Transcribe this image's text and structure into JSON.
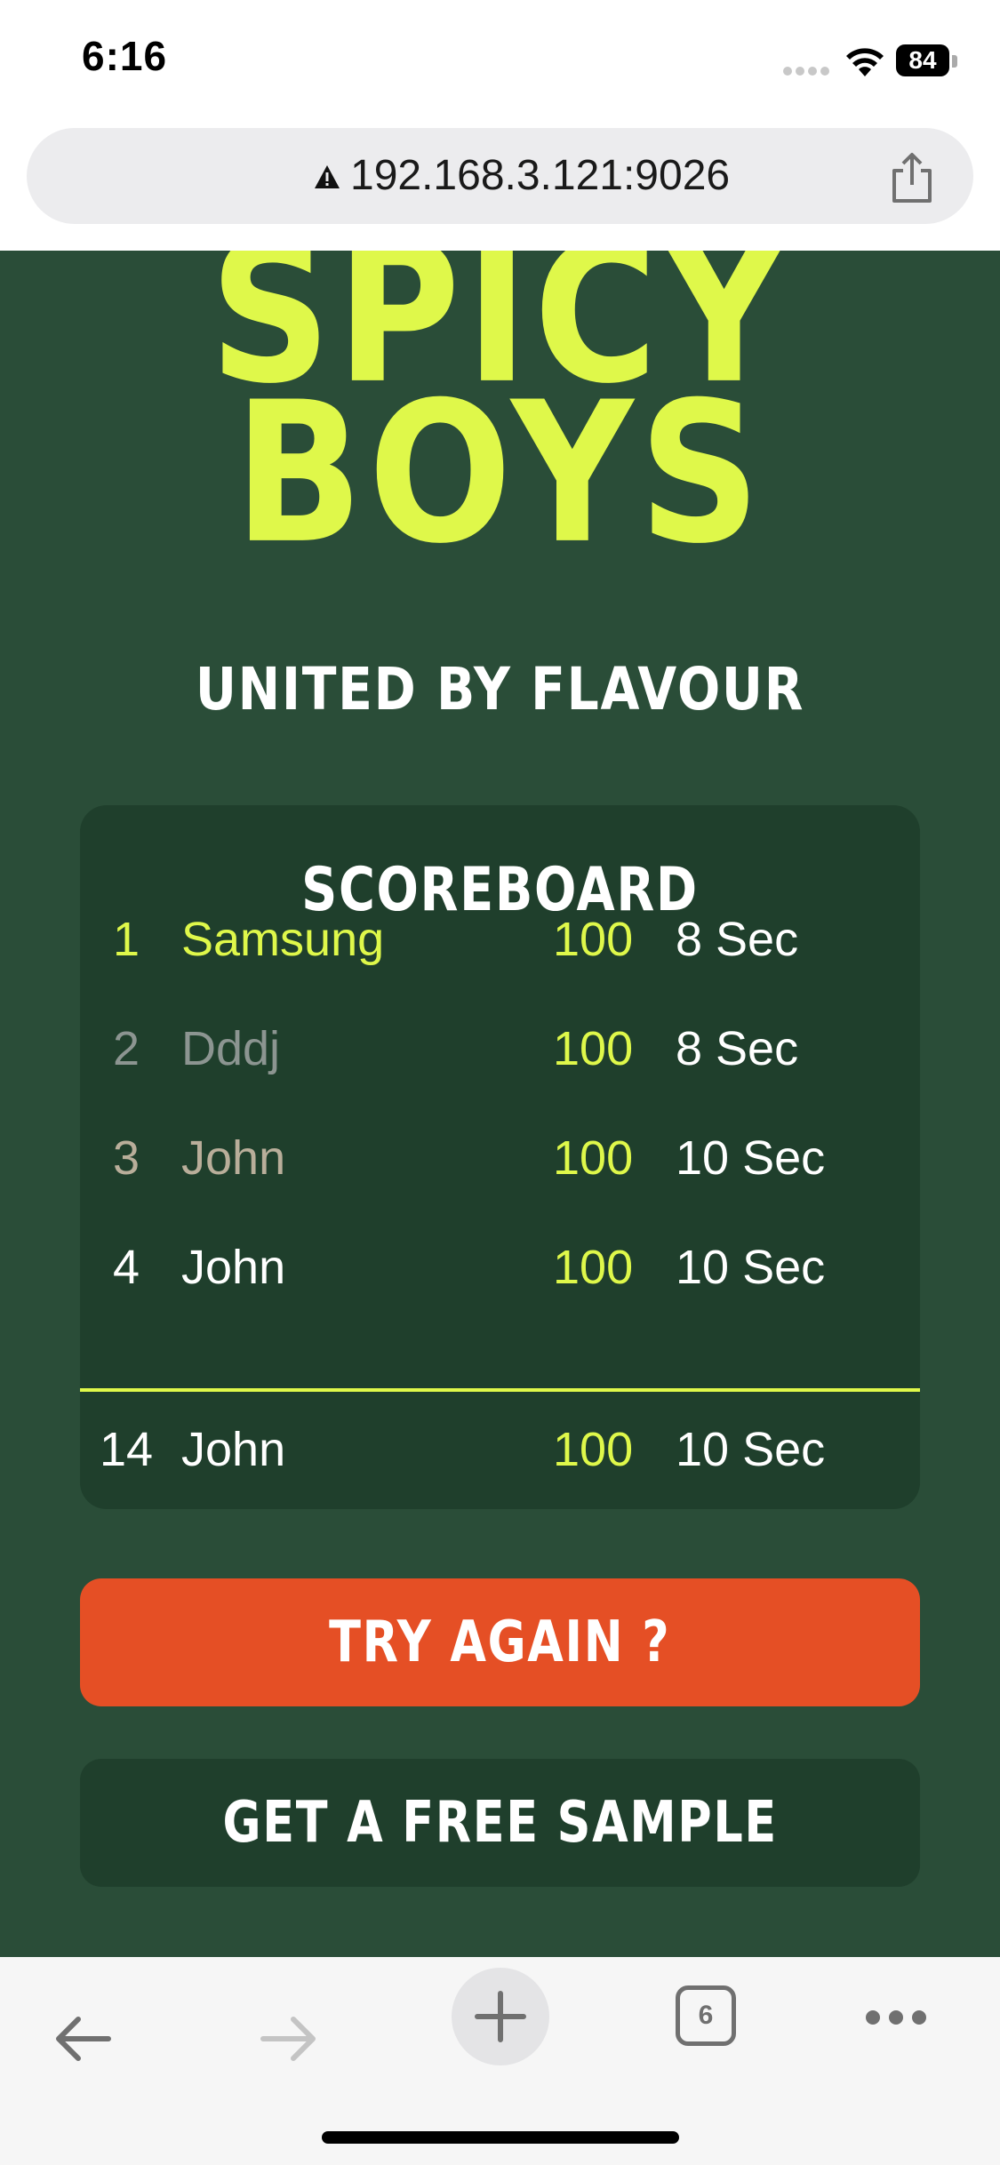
{
  "status_bar": {
    "time": "6:16",
    "battery_level": "84"
  },
  "browser": {
    "url": "192.168.3.121:9026",
    "open_tabs_count": "6"
  },
  "brand": {
    "logo_line_1": "SPICY",
    "logo_line_2": "BOYS",
    "tagline": "UNITED BY FLAVOUR",
    "accent_color": "#dff84a",
    "background_color": "#2a4d38"
  },
  "scoreboard": {
    "title": "SCOREBOARD",
    "rows": [
      {
        "rank": "1",
        "name": "Samsung",
        "score": "100",
        "time": "8 Sec",
        "rank_color": "#dff84a"
      },
      {
        "rank": "2",
        "name": "Dddj",
        "score": "100",
        "time": "8 Sec",
        "rank_color": "#8c9591"
      },
      {
        "rank": "3",
        "name": "John",
        "score": "100",
        "time": "10 Sec",
        "rank_color": "#b9ae9a"
      },
      {
        "rank": "4",
        "name": "John",
        "score": "100",
        "time": "10 Sec",
        "rank_color": "#ffffff"
      },
      {
        "rank": "14",
        "name": "John",
        "score": "100",
        "time": "10 Sec",
        "rank_color": "#ffffff"
      }
    ]
  },
  "actions": {
    "try_again_label": "TRY AGAIN ?",
    "free_sample_label": "GET A FREE SAMPLE",
    "try_again_color": "#e54f25"
  },
  "toolbar": {
    "icons": [
      "back-arrow-icon",
      "forward-arrow-icon",
      "plus-icon",
      "tabs-icon",
      "more-icon"
    ]
  }
}
